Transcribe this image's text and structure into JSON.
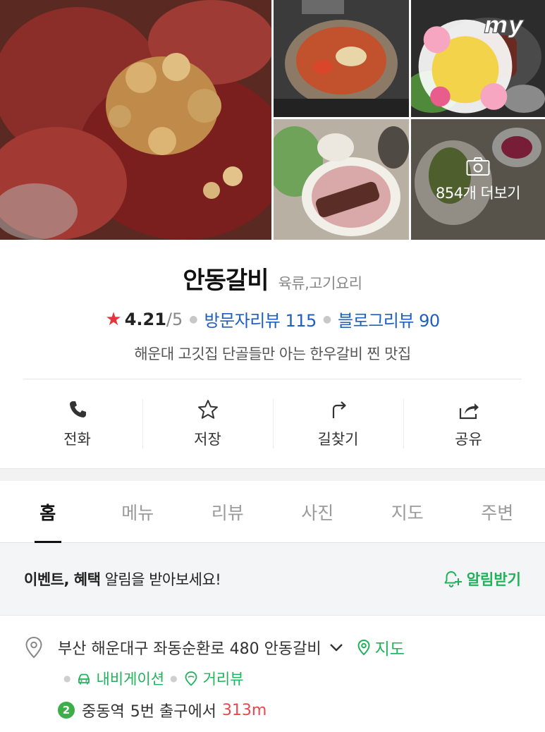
{
  "photos": {
    "more_count_label": "854개 더보기",
    "badge_text": "my"
  },
  "place": {
    "name": "안동갈비",
    "category": "육류,고기요리",
    "rating": "4.21",
    "rating_max": "/5",
    "visitor_review_label": "방문자리뷰 115",
    "blog_review_label": "블로그리뷰 90",
    "description": "해운대 고깃집 단골들만 아는 한우갈비 찐 맛집"
  },
  "actions": [
    {
      "label": "전화",
      "icon": "phone-icon"
    },
    {
      "label": "저장",
      "icon": "star-outline-icon"
    },
    {
      "label": "길찾기",
      "icon": "directions-icon"
    },
    {
      "label": "공유",
      "icon": "share-icon"
    }
  ],
  "tabs": [
    {
      "label": "홈",
      "active": true
    },
    {
      "label": "메뉴",
      "active": false
    },
    {
      "label": "리뷰",
      "active": false
    },
    {
      "label": "사진",
      "active": false
    },
    {
      "label": "지도",
      "active": false
    },
    {
      "label": "주변",
      "active": false
    }
  ],
  "notice": {
    "bold_text": "이벤트, 혜택",
    "text": " 알림을 받아보세요!",
    "button_label": "알림받기"
  },
  "address": {
    "text": "부산 해운대구 좌동순환로 480 안동갈비",
    "map_label": "지도",
    "navigation_label": "내비게이션",
    "streetview_label": "거리뷰",
    "line_number": "2",
    "station": "중동역",
    "exit_text": "5번 출구에서",
    "distance": "313m"
  },
  "colors": {
    "accent_green": "#20b25a",
    "link_blue": "#1f5fbf",
    "star_red": "#e8333b",
    "distance_red": "#e5484d",
    "line2_green": "#3dae4a"
  }
}
